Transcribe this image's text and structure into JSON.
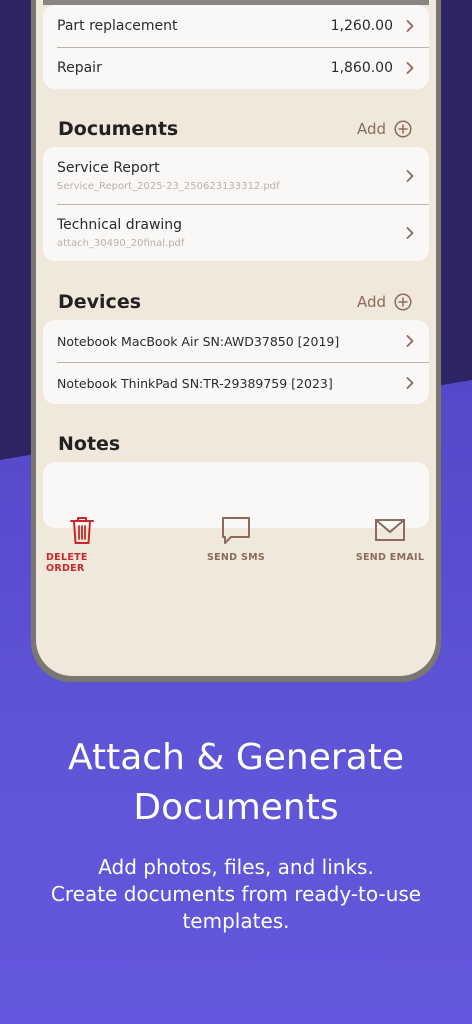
{
  "costs": [
    {
      "label": "Part replacement",
      "value": "1,260.00"
    },
    {
      "label": "Repair",
      "value": "1,860.00"
    }
  ],
  "documents": {
    "title": "Documents",
    "add_label": "Add",
    "items": [
      {
        "title": "Service Report",
        "file": "Service_Report_2025-23_250623133312.pdf"
      },
      {
        "title": "Technical drawing",
        "file": "attach_30490_20final.pdf"
      }
    ]
  },
  "devices": {
    "title": "Devices",
    "add_label": "Add",
    "items": [
      {
        "label": "Notebook MacBook Air SN:AWD37850 [2019]"
      },
      {
        "label": "Notebook ThinkPad SN:TR-29389759 [2023]"
      }
    ]
  },
  "notes": {
    "title": "Notes",
    "value": ""
  },
  "actions": {
    "delete": "DELETE ORDER",
    "sms": "SEND SMS",
    "email": "SEND EMAIL"
  },
  "promo": {
    "headline_line1": "Attach & Generate",
    "headline_line2": "Documents",
    "sub_line1": "Add photos, files, and links.",
    "sub_line2": "Create documents from ready-to-use",
    "sub_line3": "templates."
  },
  "colors": {
    "accent_brown": "#8a6c5a",
    "delete_red": "#c8282b",
    "screen_bg": "#f1e8dc",
    "promo_bg": "#5f56d6"
  }
}
